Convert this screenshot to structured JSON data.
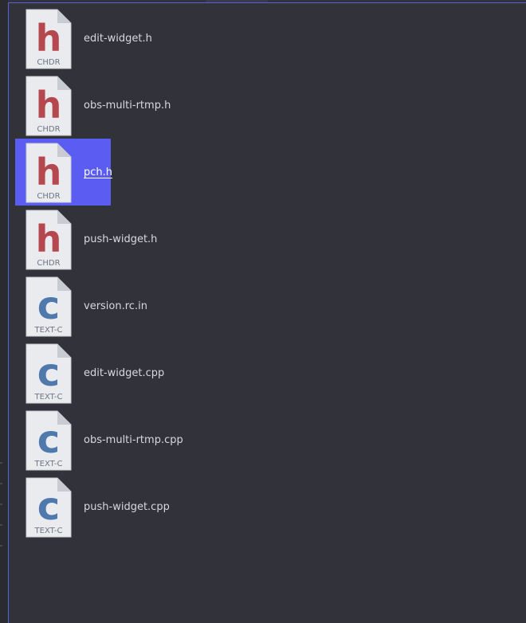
{
  "files": [
    {
      "name": "edit-widget.h",
      "glyph": "h",
      "type": "CHDR",
      "glyph_color": "#b5474f",
      "selected": false
    },
    {
      "name": "obs-multi-rtmp.h",
      "glyph": "h",
      "type": "CHDR",
      "glyph_color": "#b5474f",
      "selected": false
    },
    {
      "name": "pch.h",
      "glyph": "h",
      "type": "CHDR",
      "glyph_color": "#b5474f",
      "selected": true
    },
    {
      "name": "push-widget.h",
      "glyph": "h",
      "type": "CHDR",
      "glyph_color": "#b5474f",
      "selected": false
    },
    {
      "name": "version.rc.in",
      "glyph": "c",
      "type": "TEXT-C",
      "glyph_color": "#4f79ad",
      "selected": false
    },
    {
      "name": "edit-widget.cpp",
      "glyph": "c",
      "type": "TEXT-C",
      "glyph_color": "#4f79ad",
      "selected": false
    },
    {
      "name": "obs-multi-rtmp.cpp",
      "glyph": "c",
      "type": "TEXT-C",
      "glyph_color": "#4f79ad",
      "selected": false
    },
    {
      "name": "push-widget.cpp",
      "glyph": "c",
      "type": "TEXT-C",
      "glyph_color": "#4f79ad",
      "selected": false
    }
  ],
  "colors": {
    "background": "#31323a",
    "selection": "#5a5cf2",
    "focus_border": "#5a5de0",
    "header_glyph": "#b5474f",
    "source_glyph": "#4f79ad"
  }
}
